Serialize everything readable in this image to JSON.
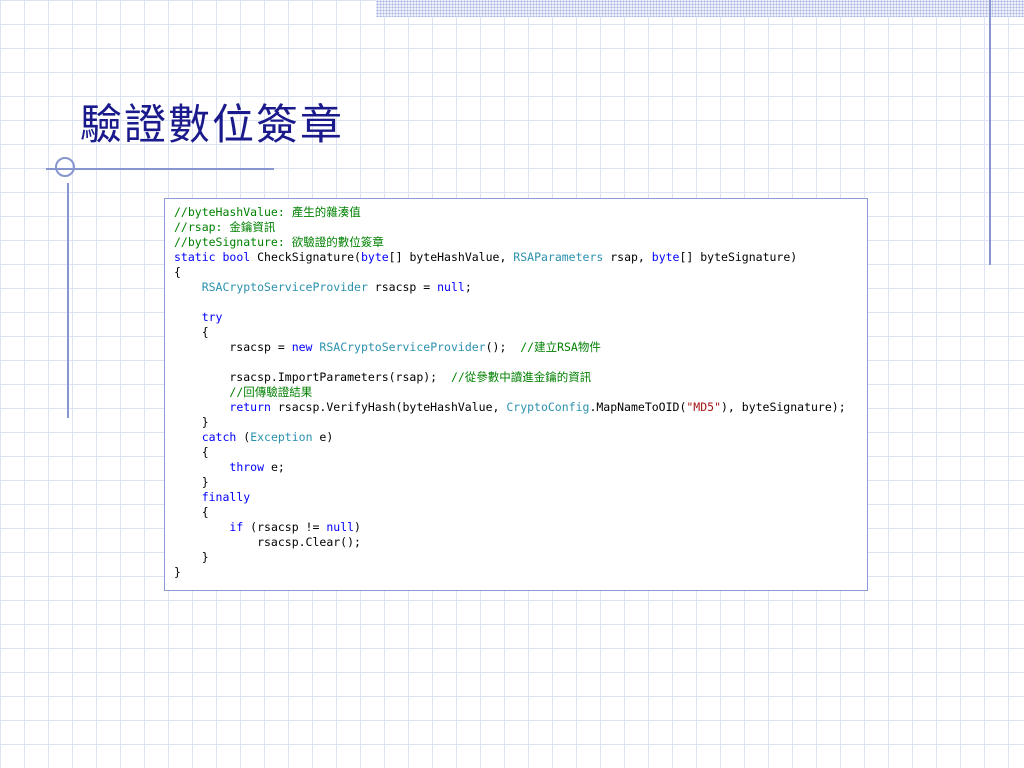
{
  "slide": {
    "title": "驗證數位簽章"
  },
  "code": {
    "lines": [
      [
        {
          "t": "//byteHashValue: 產生的雜湊值",
          "c": "comment"
        }
      ],
      [
        {
          "t": "//rsap: 金鑰資訊",
          "c": "comment"
        }
      ],
      [
        {
          "t": "//byteSignature: 欲驗證的數位簽章",
          "c": "comment"
        }
      ],
      [
        {
          "t": "static",
          "c": "kw"
        },
        {
          "t": " "
        },
        {
          "t": "bool",
          "c": "kw"
        },
        {
          "t": " CheckSignature("
        },
        {
          "t": "byte",
          "c": "kw"
        },
        {
          "t": "[] byteHashValue, "
        },
        {
          "t": "RSAParameters",
          "c": "type"
        },
        {
          "t": " rsap, "
        },
        {
          "t": "byte",
          "c": "kw"
        },
        {
          "t": "[] byteSignature)"
        }
      ],
      [
        {
          "t": "{"
        }
      ],
      [
        {
          "t": "    "
        },
        {
          "t": "RSACryptoServiceProvider",
          "c": "type"
        },
        {
          "t": " rsacsp = "
        },
        {
          "t": "null",
          "c": "kw"
        },
        {
          "t": ";"
        }
      ],
      [],
      [
        {
          "t": "    "
        },
        {
          "t": "try",
          "c": "kw"
        }
      ],
      [
        {
          "t": "    {"
        }
      ],
      [
        {
          "t": "        rsacsp = "
        },
        {
          "t": "new",
          "c": "kw"
        },
        {
          "t": " "
        },
        {
          "t": "RSACryptoServiceProvider",
          "c": "type"
        },
        {
          "t": "();  "
        },
        {
          "t": "//建立RSA物件",
          "c": "comment"
        }
      ],
      [],
      [
        {
          "t": "        rsacsp.ImportParameters(rsap);  "
        },
        {
          "t": "//從參數中讀進金鑰的資訊",
          "c": "comment"
        }
      ],
      [
        {
          "t": "        "
        },
        {
          "t": "//回傳驗證結果",
          "c": "comment"
        }
      ],
      [
        {
          "t": "        "
        },
        {
          "t": "return",
          "c": "kw"
        },
        {
          "t": " rsacsp.VerifyHash(byteHashValue, "
        },
        {
          "t": "CryptoConfig",
          "c": "type"
        },
        {
          "t": ".MapNameToOID("
        },
        {
          "t": "\"MD5\"",
          "c": "str"
        },
        {
          "t": "), byteSignature);"
        }
      ],
      [
        {
          "t": "    }"
        }
      ],
      [
        {
          "t": "    "
        },
        {
          "t": "catch",
          "c": "kw"
        },
        {
          "t": " ("
        },
        {
          "t": "Exception",
          "c": "type"
        },
        {
          "t": " e)"
        }
      ],
      [
        {
          "t": "    {"
        }
      ],
      [
        {
          "t": "        "
        },
        {
          "t": "throw",
          "c": "kw"
        },
        {
          "t": " e;"
        }
      ],
      [
        {
          "t": "    }"
        }
      ],
      [
        {
          "t": "    "
        },
        {
          "t": "finally",
          "c": "kw"
        }
      ],
      [
        {
          "t": "    {"
        }
      ],
      [
        {
          "t": "        "
        },
        {
          "t": "if",
          "c": "kw"
        },
        {
          "t": " (rsacsp != "
        },
        {
          "t": "null",
          "c": "kw"
        },
        {
          "t": ")"
        }
      ],
      [
        {
          "t": "            rsacsp.Clear();"
        }
      ],
      [
        {
          "t": "    }"
        }
      ],
      [
        {
          "t": "}"
        }
      ]
    ]
  }
}
